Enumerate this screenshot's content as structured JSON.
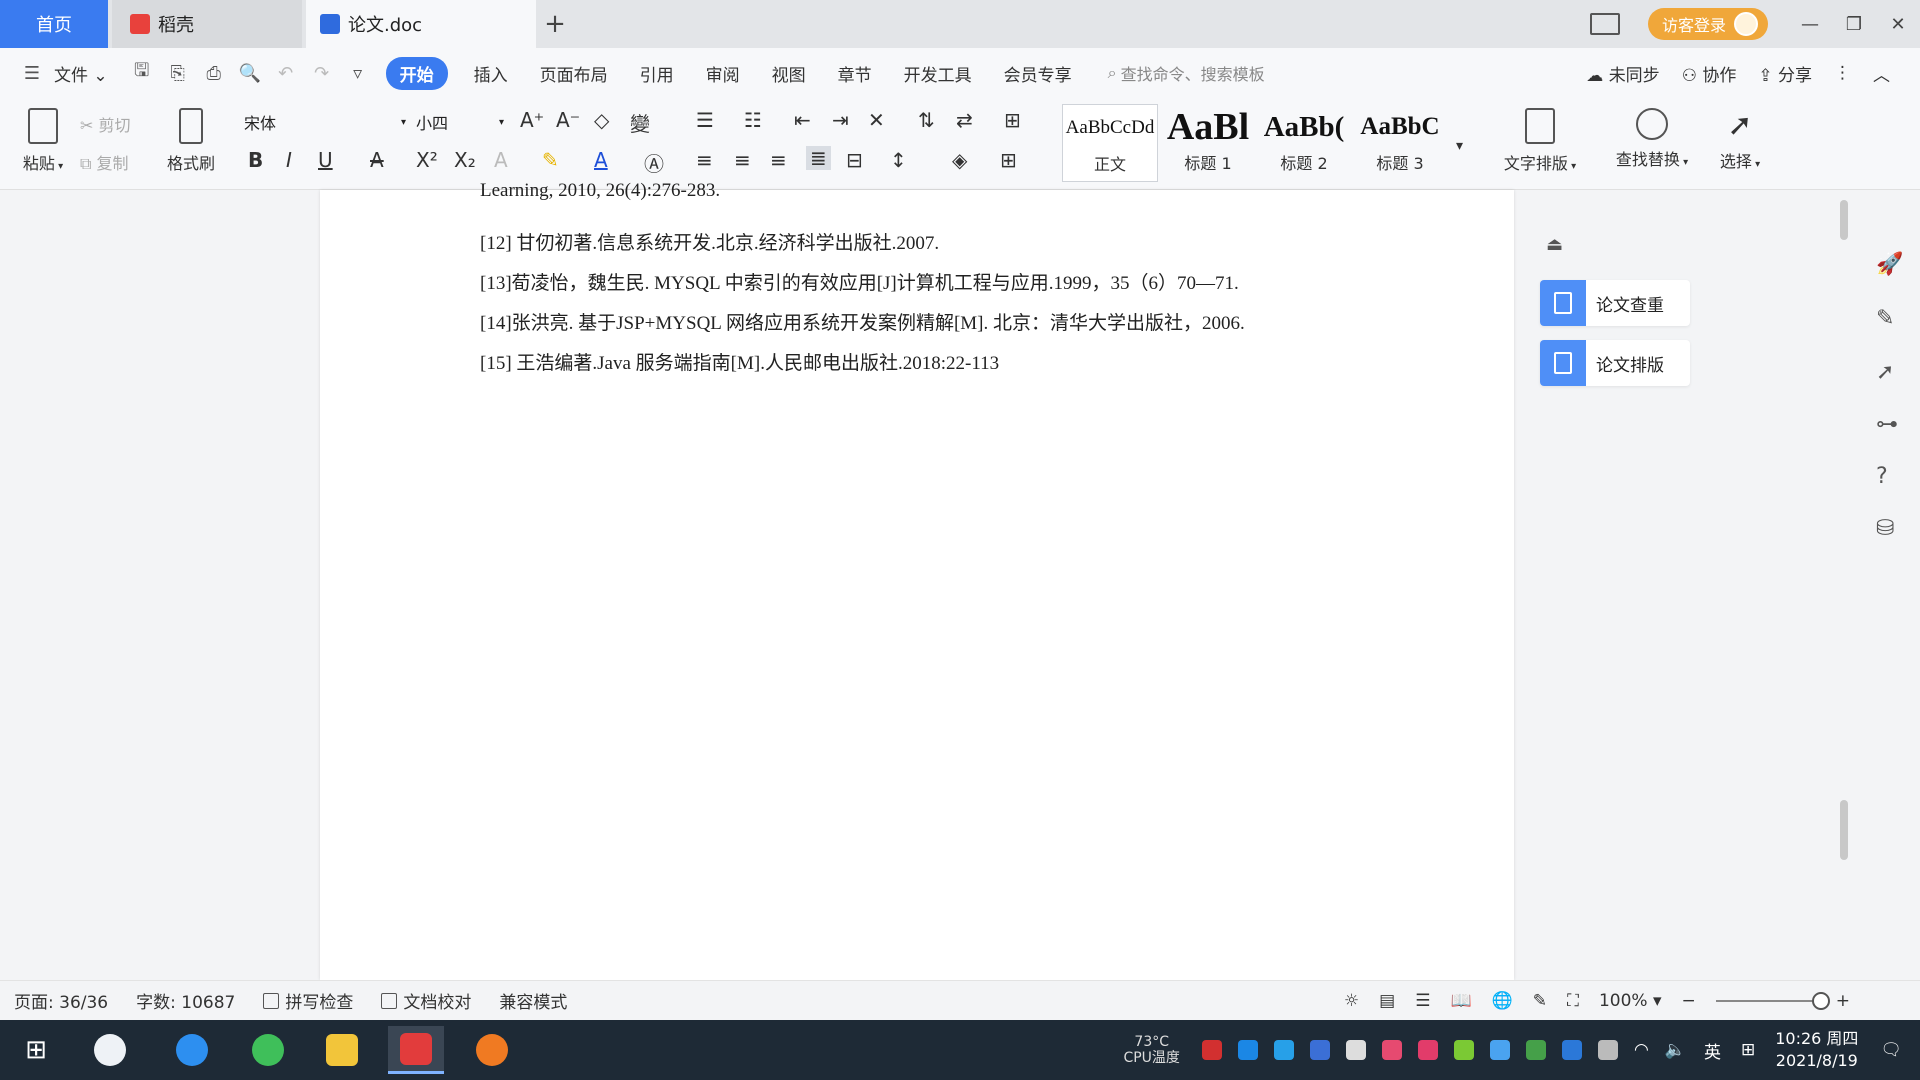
{
  "tabs": {
    "home": "首页",
    "daoke": "稻壳",
    "doc": "论文.doc",
    "add": "+"
  },
  "title_bar": {
    "login": "访客登录"
  },
  "menu": {
    "file": "文件",
    "items": [
      "开始",
      "插入",
      "页面布局",
      "引用",
      "审阅",
      "视图",
      "章节",
      "开发工具",
      "会员专享"
    ],
    "search_placeholder": "查找命令、搜索模板",
    "not_synced": "未同步",
    "collab": "协作",
    "share": "分享"
  },
  "ribbon": {
    "paste": "粘贴",
    "cut": "剪切",
    "copy": "复制",
    "format_painter": "格式刷",
    "font_name": "宋体",
    "font_size": "小四",
    "styles": [
      {
        "sample": "AaBbCcDd",
        "name": "正文"
      },
      {
        "sample": "AaBl",
        "name": "标题 1"
      },
      {
        "sample": "AaBb(",
        "name": "标题 2"
      },
      {
        "sample": "AaBbC",
        "name": "标题 3"
      }
    ],
    "text_layout": "文字排版",
    "find_replace": "查找替换",
    "select": "选择"
  },
  "document": {
    "lines": [
      "Learning,    2010,    26(4):276-283.",
      "[12]  甘仞初著.信息系统开发.北京.经济科学出版社.2007.",
      "[13]荀凌怡，魏生民. MYSQL 中索引的有效应用[J]计算机工程与应用.1999，35（6）70—71.",
      "[14]张洪亮. 基于JSP+MYSQL 网络应用系统开发案例精解[M]. 北京：清华大学出版社，2006.",
      "[15]  王浩编著.Java 服务端指南[M].人民邮电出版社.2018:22-113"
    ]
  },
  "side_panel": {
    "check": "论文查重",
    "format": "论文排版"
  },
  "status": {
    "page": "页面: 36/36",
    "words": "字数: 10687",
    "spell": "拼写检查",
    "proof": "文档校对",
    "compat": "兼容模式",
    "zoom": "100%"
  },
  "taskbar": {
    "cpu_temp": "73°C",
    "cpu_label": "CPU温度",
    "ime": "英",
    "time": "10:26 周四",
    "date": "2021/8/19"
  },
  "colors": {
    "accent": "#3a7bf0",
    "login": "#f0a73a",
    "taskbar": "#1e2a36"
  }
}
